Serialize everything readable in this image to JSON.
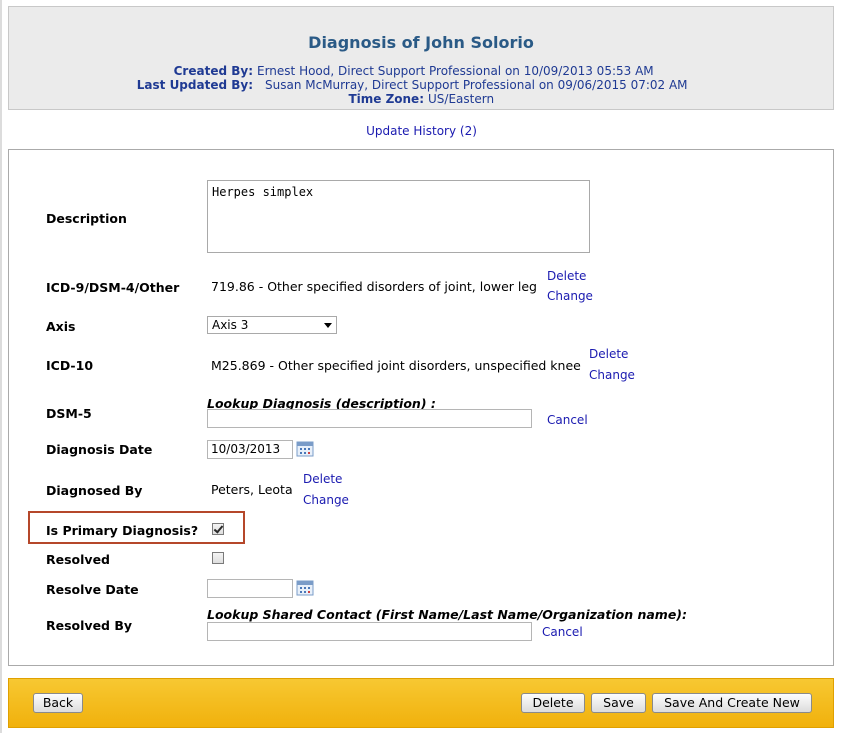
{
  "header": {
    "title": "Diagnosis of John Solorio",
    "created_by_label": "Created By:",
    "created_by_value": "Ernest Hood, Direct Support Professional on 10/09/2013 05:53 AM",
    "updated_by_label": "Last Updated By:",
    "updated_by_value": "Susan McMurray, Direct Support Professional on 09/06/2015 07:02 AM",
    "timezone_label": "Time Zone:",
    "timezone_value": "US/Eastern"
  },
  "update_history": "Update History (2)",
  "form": {
    "description_label": "Description",
    "description_value": "Herpes simplex",
    "icd9_label": "ICD-9/DSM-4/Other",
    "icd9_value": "719.86 - Other specified disorders of joint, lower leg",
    "axis_label": "Axis",
    "axis_value": "Axis 3",
    "icd10_label": "ICD-10",
    "icd10_value": "M25.869 - Other specified joint disorders, unspecified knee",
    "dsm5_label": "DSM-5",
    "dsm5_lookup_label": "Lookup Diagnosis (description) :",
    "diagnosis_date_label": "Diagnosis Date",
    "diagnosis_date_value": "10/03/2013",
    "diagnosed_by_label": "Diagnosed By",
    "diagnosed_by_value": "Peters, Leota",
    "primary_label": "Is Primary Diagnosis?",
    "primary_checked": true,
    "resolved_label": "Resolved",
    "resolved_checked": false,
    "resolve_date_label": "Resolve Date",
    "resolved_by_label": "Resolved By",
    "resolved_by_lookup_label": "Lookup Shared Contact (First Name/Last Name/Organization name):"
  },
  "links": {
    "delete": "Delete",
    "change": "Change",
    "cancel": "Cancel"
  },
  "footer": {
    "back": "Back",
    "delete": "Delete",
    "save": "Save",
    "save_new": "Save And Create New"
  },
  "colors": {
    "title": "#2a5a86",
    "link": "#1a1ab0",
    "highlight": "#b5472a",
    "footer": "#f1b10c"
  }
}
